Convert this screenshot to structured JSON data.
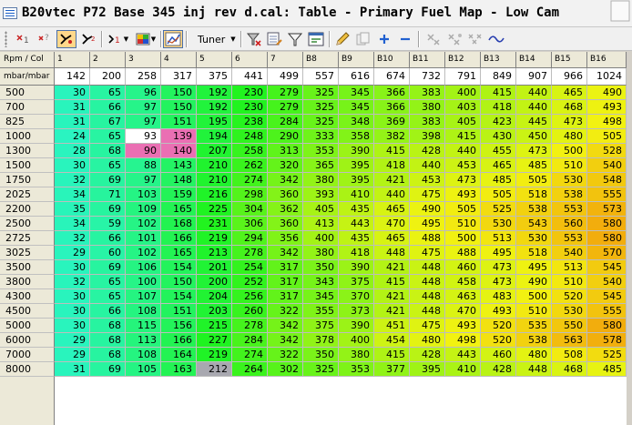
{
  "window": {
    "title": "B20vtec P72 Base 345 inj rev d.cal: Table - Primary Fuel Map - Low Cam"
  },
  "toolbar": {
    "tuner_label": "Tuner"
  },
  "table": {
    "corner_top": "Rpm / Col",
    "corner_bottom": "mbar/mbar",
    "col_indexes": [
      "1",
      "2",
      "3",
      "4",
      "5",
      "6",
      "7",
      "B8",
      "B9",
      "B10",
      "B11",
      "B12",
      "B13",
      "B14",
      "B15",
      "B16"
    ],
    "col_values": [
      "142",
      "200",
      "258",
      "317",
      "375",
      "441",
      "499",
      "557",
      "616",
      "674",
      "732",
      "791",
      "849",
      "907",
      "966",
      "1024"
    ],
    "rows": [
      {
        "rpm": "500",
        "cells": [
          "30",
          "65",
          "96",
          "150",
          "192",
          "230",
          "279",
          "325",
          "345",
          "366",
          "383",
          "400",
          "415",
          "440",
          "465",
          "490"
        ]
      },
      {
        "rpm": "700",
        "cells": [
          "31",
          "66",
          "97",
          "150",
          "192",
          "230",
          "279",
          "325",
          "345",
          "366",
          "380",
          "403",
          "418",
          "440",
          "468",
          "493"
        ]
      },
      {
        "rpm": "825",
        "cells": [
          "31",
          "67",
          "97",
          "151",
          "195",
          "238",
          "284",
          "325",
          "348",
          "369",
          "383",
          "405",
          "423",
          "445",
          "473",
          "498"
        ]
      },
      {
        "rpm": "1000",
        "cells": [
          "24",
          "65",
          "93",
          "139",
          "194",
          "248",
          "290",
          "333",
          "358",
          "382",
          "398",
          "415",
          "430",
          "450",
          "480",
          "505"
        ]
      },
      {
        "rpm": "1300",
        "cells": [
          "28",
          "68",
          "90",
          "140",
          "207",
          "258",
          "313",
          "353",
          "390",
          "415",
          "428",
          "440",
          "455",
          "473",
          "500",
          "528"
        ]
      },
      {
        "rpm": "1500",
        "cells": [
          "30",
          "65",
          "88",
          "143",
          "210",
          "262",
          "320",
          "365",
          "395",
          "418",
          "440",
          "453",
          "465",
          "485",
          "510",
          "540"
        ]
      },
      {
        "rpm": "1750",
        "cells": [
          "32",
          "69",
          "97",
          "148",
          "210",
          "274",
          "342",
          "380",
          "395",
          "421",
          "453",
          "473",
          "485",
          "505",
          "530",
          "548"
        ]
      },
      {
        "rpm": "2025",
        "cells": [
          "34",
          "71",
          "103",
          "159",
          "216",
          "298",
          "360",
          "393",
          "410",
          "440",
          "475",
          "493",
          "505",
          "518",
          "538",
          "555"
        ]
      },
      {
        "rpm": "2200",
        "cells": [
          "35",
          "69",
          "109",
          "165",
          "225",
          "304",
          "362",
          "405",
          "435",
          "465",
          "490",
          "505",
          "525",
          "538",
          "553",
          "573"
        ]
      },
      {
        "rpm": "2500",
        "cells": [
          "34",
          "59",
          "102",
          "168",
          "231",
          "306",
          "360",
          "413",
          "443",
          "470",
          "495",
          "510",
          "530",
          "543",
          "560",
          "580"
        ]
      },
      {
        "rpm": "2725",
        "cells": [
          "32",
          "66",
          "101",
          "166",
          "219",
          "294",
          "356",
          "400",
          "435",
          "465",
          "488",
          "500",
          "513",
          "530",
          "553",
          "580"
        ]
      },
      {
        "rpm": "3025",
        "cells": [
          "29",
          "60",
          "102",
          "165",
          "213",
          "278",
          "342",
          "380",
          "418",
          "448",
          "475",
          "488",
          "495",
          "518",
          "540",
          "570"
        ]
      },
      {
        "rpm": "3500",
        "cells": [
          "30",
          "69",
          "106",
          "154",
          "201",
          "254",
          "317",
          "350",
          "390",
          "421",
          "448",
          "460",
          "473",
          "495",
          "513",
          "545"
        ]
      },
      {
        "rpm": "3800",
        "cells": [
          "32",
          "65",
          "100",
          "150",
          "200",
          "252",
          "317",
          "343",
          "375",
          "415",
          "448",
          "458",
          "473",
          "490",
          "510",
          "540"
        ]
      },
      {
        "rpm": "4300",
        "cells": [
          "30",
          "65",
          "107",
          "154",
          "204",
          "256",
          "317",
          "345",
          "370",
          "421",
          "448",
          "463",
          "483",
          "500",
          "520",
          "545"
        ]
      },
      {
        "rpm": "4500",
        "cells": [
          "30",
          "66",
          "108",
          "151",
          "203",
          "260",
          "322",
          "355",
          "373",
          "421",
          "448",
          "470",
          "493",
          "510",
          "530",
          "555"
        ]
      },
      {
        "rpm": "5000",
        "cells": [
          "30",
          "68",
          "115",
          "156",
          "215",
          "278",
          "342",
          "375",
          "390",
          "451",
          "475",
          "493",
          "520",
          "535",
          "550",
          "580"
        ]
      },
      {
        "rpm": "6000",
        "cells": [
          "29",
          "68",
          "113",
          "166",
          "227",
          "284",
          "342",
          "378",
          "400",
          "454",
          "480",
          "498",
          "520",
          "538",
          "563",
          "578"
        ]
      },
      {
        "rpm": "7000",
        "cells": [
          "29",
          "68",
          "108",
          "164",
          "219",
          "274",
          "322",
          "350",
          "380",
          "415",
          "428",
          "443",
          "460",
          "480",
          "508",
          "525"
        ]
      },
      {
        "rpm": "8000",
        "cells": [
          "31",
          "69",
          "105",
          "163",
          "212",
          "264",
          "302",
          "325",
          "353",
          "377",
          "395",
          "410",
          "428",
          "448",
          "468",
          "485"
        ]
      }
    ],
    "pink_cells": [
      [
        3,
        3
      ],
      [
        4,
        2
      ],
      [
        4,
        3
      ]
    ],
    "white_cells": [
      [
        3,
        2
      ]
    ],
    "gray_cells": [
      [
        19,
        4
      ]
    ]
  },
  "colors": {
    "pink": "#ea6fb3",
    "white": "#ffffff",
    "gray": "#a8a8b0",
    "header_bg": "#ece9d8"
  }
}
